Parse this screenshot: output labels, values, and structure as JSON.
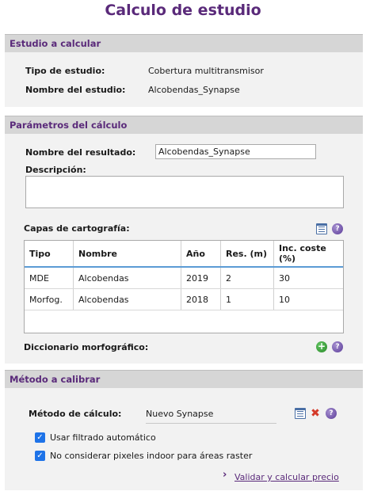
{
  "title": "Calculo de estudio",
  "estudio": {
    "header": "Estudio a calcular",
    "tipo_label": "Tipo de estudio:",
    "tipo_value": "Cobertura multitransmisor",
    "nombre_label": "Nombre del estudio:",
    "nombre_value": "Alcobendas_Synapse"
  },
  "parametros": {
    "header": "Parámetros del cálculo",
    "resultado_label": "Nombre del resultado:",
    "resultado_value": "Alcobendas_Synapse",
    "descripcion_label": "Descripción:",
    "descripcion_value": "",
    "capas_label": "Capas de cartografía:",
    "table": {
      "headers": [
        "Tipo",
        "Nombre",
        "Año",
        "Res. (m)",
        "Inc. coste (%)"
      ],
      "rows": [
        [
          "MDE",
          "Alcobendas",
          "2019",
          "2",
          "30"
        ],
        [
          "Morfog.",
          "Alcobendas",
          "2018",
          "1",
          "10"
        ]
      ]
    },
    "diccionario_label": "Diccionario morfográfico:"
  },
  "metodo": {
    "header": "Método a calibrar",
    "metodo_label": "Método de cálculo:",
    "metodo_value": "Nuevo Synapse",
    "filtrado_label": "Usar filtrado automático",
    "indoor_label": "No considerar pixeles indoor para áreas raster",
    "validar_link": "Validar y calcular precio",
    "chevron": "›"
  },
  "icons": {
    "help": "?",
    "add": "+",
    "remove": "✖",
    "check": "✓"
  }
}
